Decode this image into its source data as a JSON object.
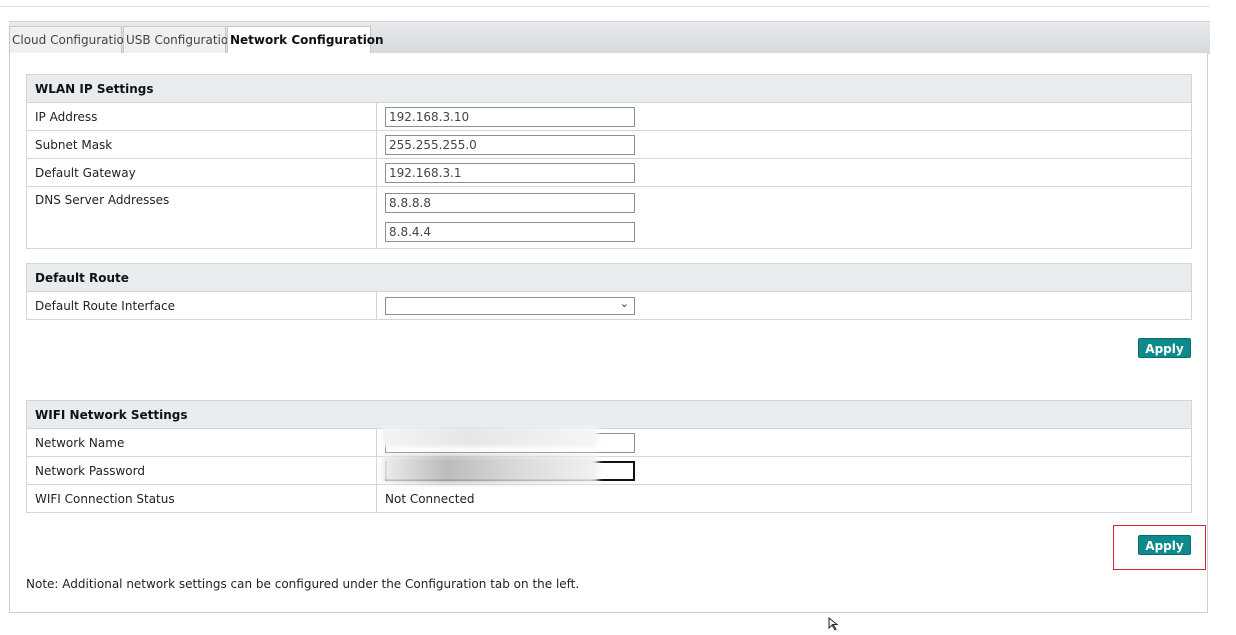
{
  "tabs": [
    {
      "label": "Cloud Configuration"
    },
    {
      "label": "USB Configuration"
    },
    {
      "label": "Network Configuration",
      "active": true
    }
  ],
  "wlan": {
    "title": "WLAN IP Settings",
    "ip_label": "IP Address",
    "ip_value": "192.168.3.10",
    "subnet_label": "Subnet Mask",
    "subnet_value": "255.255.255.0",
    "gateway_label": "Default Gateway",
    "gateway_value": "192.168.3.1",
    "dns_label": "DNS Server Addresses",
    "dns1_value": "8.8.8.8",
    "dns2_value": "8.8.4.4"
  },
  "route": {
    "title": "Default Route",
    "iface_label": "Default Route Interface",
    "iface_value": ""
  },
  "apply_label": "Apply",
  "wifi": {
    "title": "WIFI Network Settings",
    "name_label": "Network Name",
    "password_label": "Network Password",
    "status_label": "WIFI Connection Status",
    "status_value": "Not Connected"
  },
  "note": "Note: Additional network settings can be configured under the Configuration tab on the left.",
  "colors": {
    "apply_button": "#0e8a8a",
    "highlight_box": "#d9252b",
    "section_header": "#e9ecee"
  },
  "icons": {
    "dropdown": "chevron-down-icon",
    "cursor": "mouse-cursor-icon"
  }
}
